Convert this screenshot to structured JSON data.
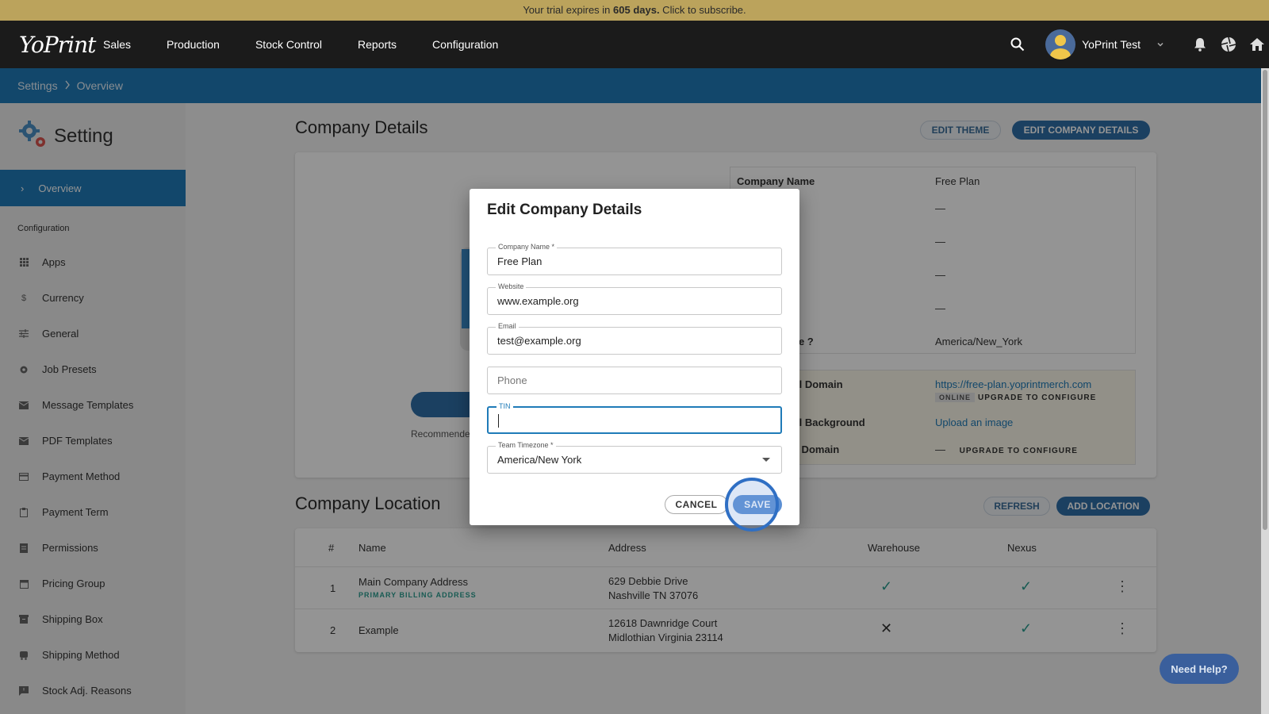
{
  "trial_banner": {
    "prefix": "Your trial expires in ",
    "days": "605 days.",
    "suffix": " Click to subscribe."
  },
  "topbar": {
    "logo": "YoPrint",
    "nav": [
      "Sales",
      "Production",
      "Stock Control",
      "Reports",
      "Configuration"
    ],
    "user_name": "YoPrint Test"
  },
  "breadcrumb": {
    "root": "Settings",
    "current": "Overview"
  },
  "sidebar": {
    "title": "Setting",
    "active_item": "Overview",
    "section_label": "Configuration",
    "items": [
      {
        "label": "Apps",
        "icon": "apps-grid-icon"
      },
      {
        "label": "Currency",
        "icon": "dollar-icon"
      },
      {
        "label": "General",
        "icon": "sliders-icon"
      },
      {
        "label": "Job Presets",
        "icon": "gear-icon"
      },
      {
        "label": "Message Templates",
        "icon": "mail-icon"
      },
      {
        "label": "PDF Templates",
        "icon": "mail-icon"
      },
      {
        "label": "Payment Method",
        "icon": "credit-card-icon"
      },
      {
        "label": "Payment Term",
        "icon": "clipboard-icon"
      },
      {
        "label": "Permissions",
        "icon": "document-icon"
      },
      {
        "label": "Pricing Group",
        "icon": "calendar-icon"
      },
      {
        "label": "Shipping Box",
        "icon": "archive-icon"
      },
      {
        "label": "Shipping Method",
        "icon": "truck-icon"
      },
      {
        "label": "Stock Adj. Reasons",
        "icon": "feedback-icon"
      }
    ]
  },
  "company_details": {
    "title": "Company Details",
    "edit_theme": "EDIT THEME",
    "edit_company": "EDIT COMPANY DETAILS",
    "recommended_text": "Recommende",
    "info": {
      "company_name_label": "Company Name",
      "company_name_value": "Free Plan",
      "dash": "—",
      "timezone_label_partial": "ne",
      "timezone_value": "America/New_York"
    },
    "domains": {
      "portal_domain_label_partial": "rtal Domain",
      "portal_domain_value": "https://free-plan.yoprintmerch.com",
      "online_badge": "ONLINE",
      "upgrade_text": "UPGRADE TO CONFIGURE",
      "portal_background_label_partial": "rtal Background",
      "upload_image": "Upload an image",
      "custom_domain_label_partial": "g Domain",
      "dash": "—"
    }
  },
  "company_location": {
    "title": "Company Location",
    "refresh": "REFRESH",
    "add_location": "ADD LOCATION",
    "columns": [
      "#",
      "Name",
      "Address",
      "Warehouse",
      "Nexus"
    ],
    "rows": [
      {
        "num": "1",
        "name": "Main Company Address",
        "tag": "PRIMARY BILLING ADDRESS",
        "address_line1": "629 Debbie Drive",
        "address_line2": "Nashville TN 37076",
        "warehouse": true,
        "nexus": true
      },
      {
        "num": "2",
        "name": "Example",
        "tag": "",
        "address_line1": "12618 Dawnridge Court",
        "address_line2": "Midlothian Virginia 23114",
        "warehouse": false,
        "nexus": true
      }
    ]
  },
  "modal": {
    "title": "Edit Company Details",
    "fields": {
      "company_name": {
        "label": "Company Name *",
        "value": "Free Plan"
      },
      "website": {
        "label": "Website",
        "value": "www.example.org"
      },
      "email": {
        "label": "Email",
        "value": "test@example.org"
      },
      "phone": {
        "placeholder": "Phone"
      },
      "tin": {
        "label": "TIN",
        "value": ""
      },
      "timezone": {
        "label": "Team Timezone *",
        "value": "America/New York"
      }
    },
    "cancel": "CANCEL",
    "save": "SAVE"
  },
  "help_button": "Need Help?",
  "colors": {
    "banner": "#bba35c",
    "topbar": "#1b1b1b",
    "accent_blue": "#1f7bb8",
    "button_blue": "#2f6fa8",
    "check_green": "#2a9d8f"
  }
}
